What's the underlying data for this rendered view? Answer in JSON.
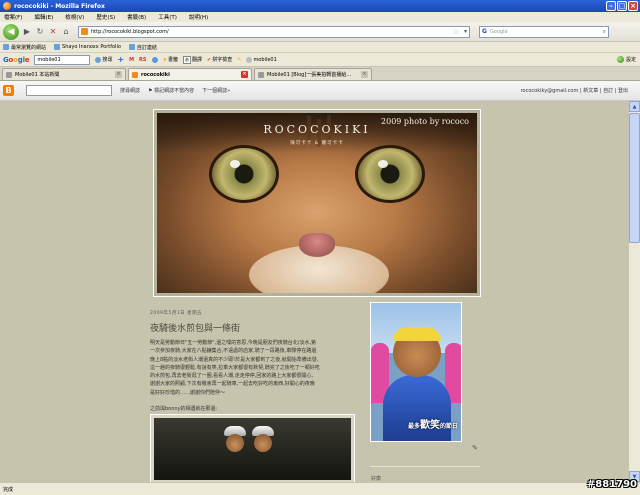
{
  "window": {
    "title": "rococokiki - Mozilla Firefox"
  },
  "menu": [
    "檔案(F)",
    "編輯(E)",
    "檢視(V)",
    "歷史(S)",
    "書籤(B)",
    "工具(T)",
    "說明(H)"
  ],
  "nav": {
    "url": "http://rococokiki.blogspot.com/",
    "search_placeholder": "Google"
  },
  "bookmarks": [
    "最常瀏覽的網站",
    "Shayo Inanoxx Portfolio",
    "自訂連結"
  ],
  "google_toolbar": {
    "search_value": "mobile01",
    "search_label": "搜尋",
    "bookmark_label": "書籤",
    "translate_label": "翻譯",
    "spellcheck_label": "拼字檢查",
    "tag_label": "mobile01",
    "settings_label": "設定"
  },
  "tabs": [
    {
      "label": "Mobile01 本站新聞",
      "active": false
    },
    {
      "label": "rococokiki",
      "active": true
    },
    {
      "label": "Mobile01 [Blog]一張美拍轉首播給...",
      "active": false
    }
  ],
  "blogger": {
    "search_blog": "搜尋網誌",
    "flag_blog": "標記網誌不當內容",
    "next_blog": "下一個網誌»",
    "account": "rococokiky@gmail.com",
    "new_post": "新文章",
    "customize": "自訂",
    "sign_out": "登出"
  },
  "header": {
    "title": "ROCOCOKIKI",
    "subtitle": "陳可卡卡 & 羅可卡卡",
    "photo_credit": "2009 photo by rococo"
  },
  "post": {
    "date": "2009年5月1日 星期五",
    "title": "夜騎後水煎包與一條街",
    "body": "明天是勞動節日\"五一勞動節\",還之嘿的意思,今晚是朋友們夜騎台北/淡水,第一次參加夜騎,大家在八點鐘集合,不遠處的店家,騎了一段路後,車隊停在路邊,晚上8點的淡水老街人潮還真的不少耶!於是大家都到了之後,就開始準備出發,這一趟的夜騎很輕鬆,有說有笑,拉車大家都很有默契,騎完了之後吃了一頓好吃的...好開心的夜晚啊～",
    "caption": "之前與bonny的相遇就在那邊:",
    "body_lines": [
      "明天是勞動節日\"五一勞動節\",還之嘿的意思,今晚是朋友們夜騎台北/淡水,第",
      "一次參加夜騎,大家在八點鐘集合,不遠處的店家,騎了一段路後,車隊停在路邊",
      "晚上8點的淡水老街人潮還真的不少耶!於是大家都到了之後,就開始準備出發,",
      "這一趟的夜騎很輕鬆,有說有笑,拉車大家都很有默契,騎完了之後吃了一頓好吃",
      "的水煎包,再去老街逛了一圈,看看人潮,走走停停,回家的路上大家都很開心,",
      "謝謝大家的照顧,下次有機會再一起騎車,一起去吃好吃的東西,好開心的夜晚",
      "是好好珍惜的……謝謝你們陪伴～"
    ]
  },
  "sidebar": {
    "photo_caption_prefix": "最多",
    "photo_caption_big": "歡笑",
    "photo_caption_suffix": "的節日",
    "heading": "好康"
  },
  "status": "完成",
  "watermark": "#881790"
}
